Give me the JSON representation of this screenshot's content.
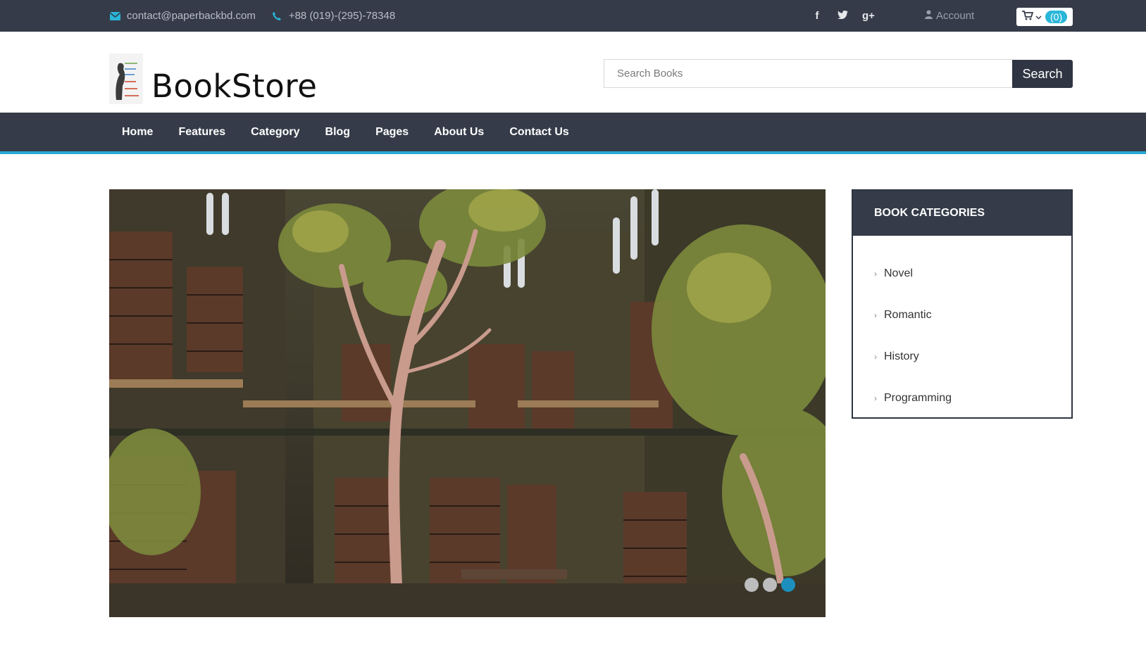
{
  "topbar": {
    "email": "contact@paperbackbd.com",
    "phone": "+88 (019)-(295)-78348",
    "social": [
      "f",
      "t",
      "g+"
    ],
    "account_label": "Account",
    "cart_count": "(0)"
  },
  "header": {
    "brand": "BookStore",
    "search_placeholder": "Search Books",
    "search_button": "Search"
  },
  "nav": {
    "items": [
      "Home",
      "Features",
      "Category",
      "Blog",
      "Pages",
      "About Us",
      "Contact Us"
    ]
  },
  "slider": {
    "slide_count": 3,
    "active_slide": 3
  },
  "sidebar": {
    "title": "BOOK CATEGORIES",
    "items": [
      "Novel",
      "Romantic",
      "History",
      "Programming"
    ]
  },
  "colors": {
    "dark": "#353b48",
    "accent": "#29a7d3",
    "cart_badge": "#29b6d8"
  },
  "icons": {
    "email": "envelope-icon",
    "phone": "phone-icon",
    "account": "user-icon",
    "cart": "shopping-cart-icon",
    "category_bullet": "chevron-right-icon"
  }
}
